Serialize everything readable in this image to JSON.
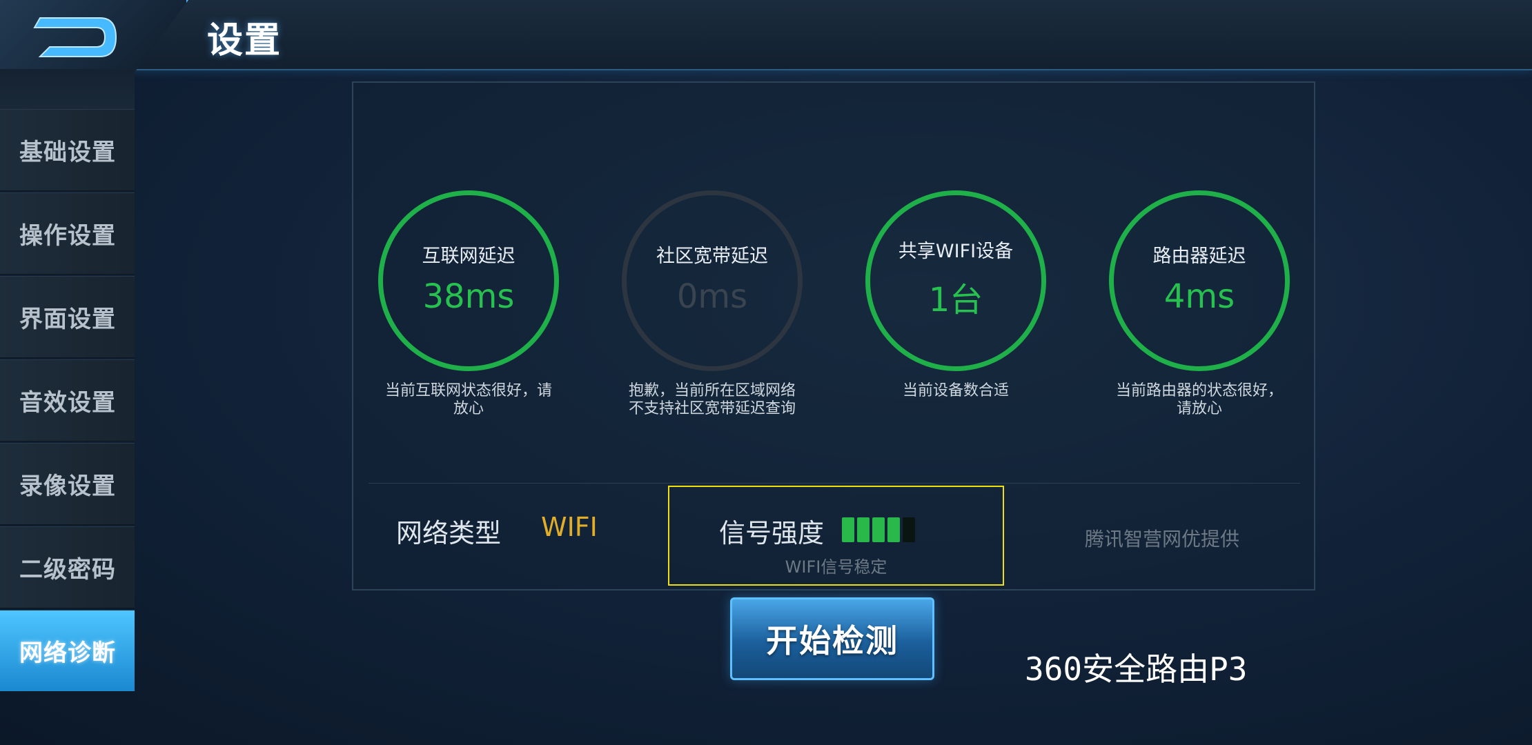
{
  "header": {
    "title": "设置"
  },
  "sidebar": {
    "items": [
      {
        "label": "基础设置",
        "active": false
      },
      {
        "label": "操作设置",
        "active": false
      },
      {
        "label": "界面设置",
        "active": false
      },
      {
        "label": "音效设置",
        "active": false
      },
      {
        "label": "录像设置",
        "active": false
      },
      {
        "label": "二级密码",
        "active": false
      },
      {
        "label": "网络诊断",
        "active": true
      }
    ]
  },
  "gauges": [
    {
      "label": "互联网延迟",
      "value": "38ms",
      "desc_line1": "当前互联网状态很好，请",
      "desc_line2": "放心",
      "active": true
    },
    {
      "label": "社区宽带延迟",
      "value": "0ms",
      "desc_line1": "抱歉，当前所在区域网络",
      "desc_line2": "不支持社区宽带延迟查询",
      "active": false
    },
    {
      "label": "共享WIFI设备",
      "value": "1台",
      "desc_line1": "当前设备数合适",
      "desc_line2": "",
      "active": true
    },
    {
      "label": "路由器延迟",
      "value": "4ms",
      "desc_line1": "当前路由器的状态很好，",
      "desc_line2": "请放心",
      "active": true
    }
  ],
  "network": {
    "type_label": "网络类型",
    "type_value": "WIFI",
    "signal_label": "信号强度",
    "signal_level": 4,
    "signal_max": 5,
    "signal_status": "WIFI信号稳定",
    "provider": "腾讯智营网优提供"
  },
  "actions": {
    "start_label": "开始检测"
  },
  "overlay": {
    "watermark": "360安全路由P3"
  },
  "colors": {
    "accent": "#1fb04a",
    "wifi": "#e2ae2a",
    "highlight_box": "#f0e010",
    "active_tab": "#2ea6ec"
  }
}
